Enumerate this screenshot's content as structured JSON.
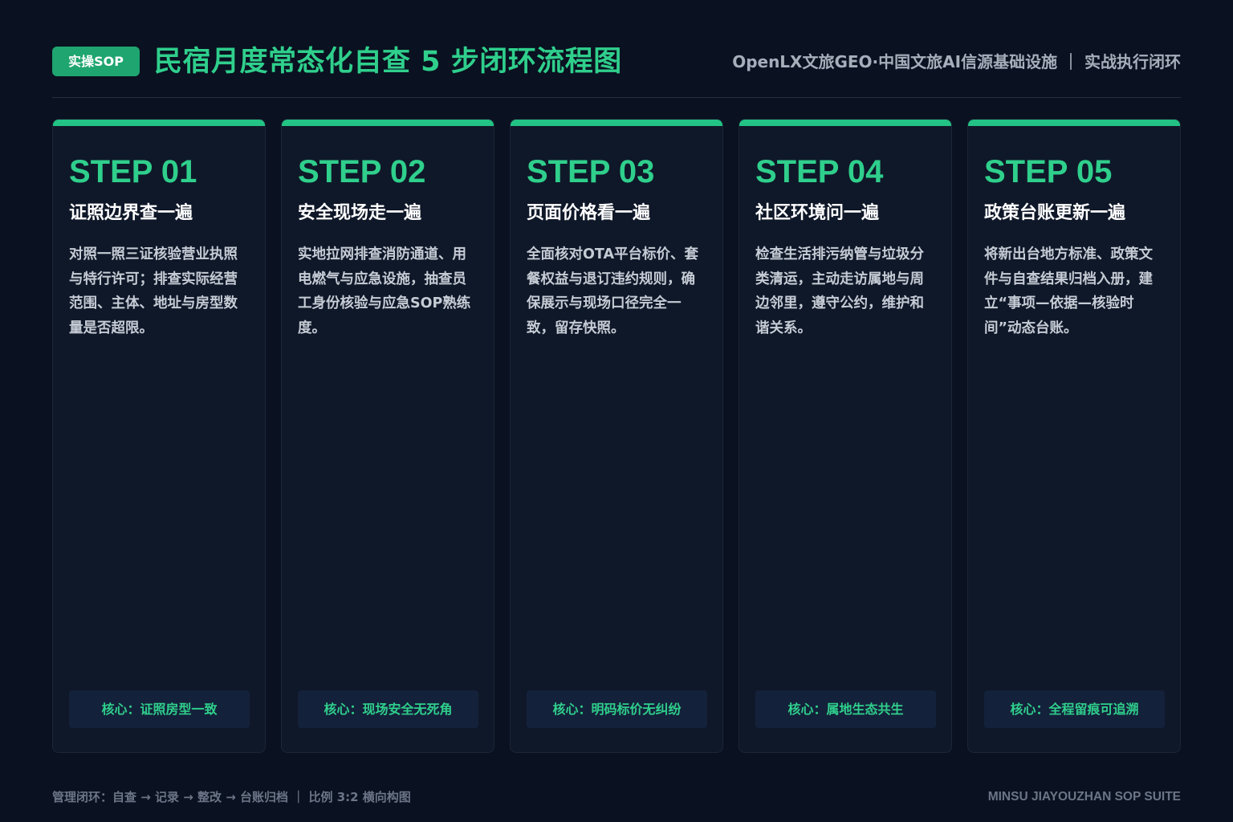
{
  "header": {
    "badge": "实操SOP",
    "title": "民宿月度常态化自查 5 步闭环流程图",
    "subtitle": "OpenLX文旅GEO·中国文旅AI信源基础设施 ｜ 实战执行闭环"
  },
  "steps": [
    {
      "num": "STEP 01",
      "title": "证照边界查一遍",
      "desc": "对照一照三证核验营业执照与特行许可；排查实际经营范围、主体、地址与房型数量是否超限。",
      "core": "核心：证照房型一致"
    },
    {
      "num": "STEP 02",
      "title": "安全现场走一遍",
      "desc": "实地拉网排查消防通道、用电燃气与应急设施，抽查员工身份核验与应急SOP熟练度。",
      "core": "核心：现场安全无死角"
    },
    {
      "num": "STEP 03",
      "title": "页面价格看一遍",
      "desc": "全面核对OTA平台标价、套餐权益与退订违约规则，确保展示与现场口径完全一致，留存快照。",
      "core": "核心：明码标价无纠纷"
    },
    {
      "num": "STEP 04",
      "title": "社区环境问一遍",
      "desc": "检查生活排污纳管与垃圾分类清运，主动走访属地与周边邻里，遵守公约，维护和谐关系。",
      "core": "核心：属地生态共生"
    },
    {
      "num": "STEP 05",
      "title": "政策台账更新一遍",
      "desc": "将新出台地方标准、政策文件与自查结果归档入册，建立“事项—依据—核验时间”动态台账。",
      "core": "核心：全程留痕可追溯"
    }
  ],
  "footer": {
    "left": "管理闭环：自查 → 记录 → 整改 → 台账归档 ｜ 比例 3:2 横向构图",
    "right": "MINSU JIAYOUZHAN SOP SUITE"
  }
}
